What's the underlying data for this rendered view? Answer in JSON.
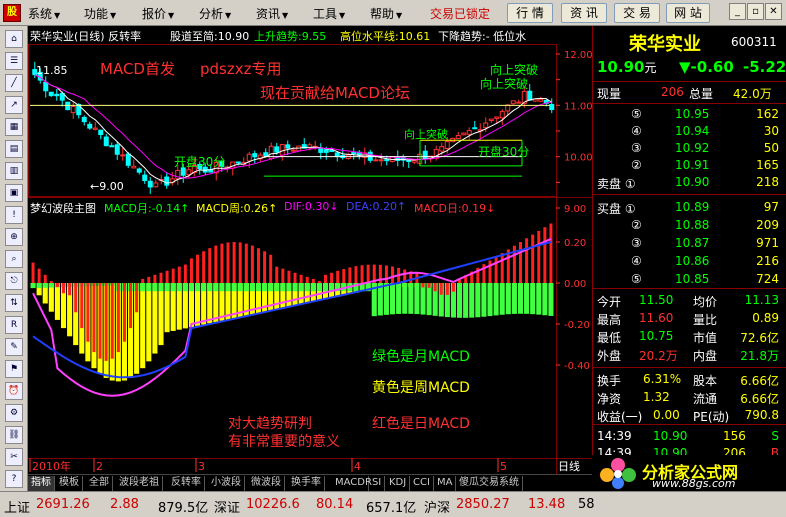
{
  "menu": {
    "items": [
      "系统",
      "功能",
      "报价",
      "分析",
      "资讯",
      "工具",
      "帮助"
    ],
    "trade_status": "交易已锁定",
    "buttons": [
      "行 情",
      "资 讯",
      "交 易",
      "网 站"
    ]
  },
  "main_header": {
    "title": "荣华实业(日线) 反转率",
    "date_label": "股道至简:10.90",
    "trend_up": "上升趋势:9.55",
    "high_line": "高位水平线:10.61",
    "trend_down": "下降趋势:- 低位水"
  },
  "main_chart": {
    "y_ticks": [
      "12.00",
      "11.50",
      "11.00",
      "10.50",
      "10.00",
      "9.50",
      "9.00"
    ],
    "high_mark": "11.85",
    "low_mark": "←9.00",
    "annotations": {
      "macd_first": "MACD首发",
      "author": "pdszxz专用",
      "dedication": "现在贡献给MACD论坛",
      "open30_left": "开盘30分",
      "open30_right": "开盘30分",
      "break_up": "向上突破",
      "break_up2": "向上突破",
      "upper_mid": "向上突破"
    },
    "colors": {
      "up": "#ff3030",
      "down": "#00ffff",
      "ma1": "#ffffff",
      "ma2": "#ff00ff"
    }
  },
  "indicator_header": {
    "title": "梦幻波段主图",
    "macd_month": "MACD月:-0.14↑",
    "macd_week": "MACD周:0.26↑",
    "dif": "DIF:0.30↓",
    "dea": "DEA:0.20↑",
    "macd_day": "MACD日:0.19↓"
  },
  "indicator_chart": {
    "y_ticks": [
      "0.20",
      "0.00",
      "-0.20",
      "-0.40"
    ],
    "labels": {
      "green": "绿色是月MACD",
      "yellow": "黄色是周MACD",
      "red": "红色是日MACD",
      "note1": "对大趋势研判",
      "note2": "有非常重要的意义"
    }
  },
  "time_axis": {
    "labels": [
      "2010年",
      "2",
      "3",
      "4",
      "5"
    ],
    "period": "日线"
  },
  "tabs": [
    "指标",
    "模板",
    "全部",
    "波段老祖",
    "反转率",
    "小波段",
    "微波段",
    "换手率",
    "MACD",
    "RSI",
    "KDJ",
    "CCI",
    "MA",
    "傻瓜交易系统"
  ],
  "status_bar": {
    "sh_label": "上证",
    "sh_value": "2691.26",
    "sh_change": "2.88",
    "sh_amount": "879.5亿",
    "sz_label": "深证",
    "sz_value": "10226.6",
    "sz_change": "80.14",
    "sz_amount": "657.1亿",
    "hs_label": "沪深",
    "hs_value": "2850.27",
    "hs_change": "13.48",
    "hs_amount": "58"
  },
  "quote": {
    "name": "荣华实业",
    "code": "600311",
    "price": "10.90",
    "price_unit": "元",
    "change": "▼-0.60",
    "pct": "-5.22",
    "now_label": "现量",
    "now_value": "206",
    "total_label": "总量",
    "total_value": "42.0万",
    "asks": [
      {
        "n": "⑤",
        "p": "10.95",
        "v": "162"
      },
      {
        "n": "④",
        "p": "10.94",
        "v": "30"
      },
      {
        "n": "③",
        "p": "10.92",
        "v": "50"
      },
      {
        "n": "②",
        "p": "10.91",
        "v": "165"
      },
      {
        "n": "卖盘 ①",
        "p": "10.90",
        "v": "218"
      }
    ],
    "bids": [
      {
        "n": "买盘 ①",
        "p": "10.89",
        "v": "97"
      },
      {
        "n": "②",
        "p": "10.88",
        "v": "209"
      },
      {
        "n": "③",
        "p": "10.87",
        "v": "971"
      },
      {
        "n": "④",
        "p": "10.86",
        "v": "216"
      },
      {
        "n": "⑤",
        "p": "10.85",
        "v": "724"
      }
    ],
    "stats": [
      {
        "l1": "今开",
        "v1": "11.50",
        "l2": "均价",
        "v2": "11.13"
      },
      {
        "l1": "最高",
        "v1": "11.60",
        "l2": "量比",
        "v2": "0.89"
      },
      {
        "l1": "最低",
        "v1": "10.75",
        "l2": "市值",
        "v2": "72.6亿"
      },
      {
        "l1": "外盘",
        "v1": "20.2万",
        "l2": "内盘",
        "v2": "21.8万"
      }
    ],
    "stats2": [
      {
        "l1": "换手",
        "v1": "6.31%",
        "l2": "股本",
        "v2": "6.66亿"
      },
      {
        "l1": "净资",
        "v1": "1.32",
        "l2": "流通",
        "v2": "6.66亿"
      },
      {
        "l1": "收益(一)",
        "v1": "0.00",
        "l2": "PE(动)",
        "v2": "790.8"
      }
    ],
    "ticks": [
      {
        "t": "14:39",
        "p": "10.90",
        "v": "156",
        "s": "S"
      },
      {
        "t": "14:39",
        "p": "10.90",
        "v": "206",
        "s": "B"
      }
    ]
  },
  "logo": {
    "name": "分析家公式网",
    "url": "www.88gs.com"
  }
}
